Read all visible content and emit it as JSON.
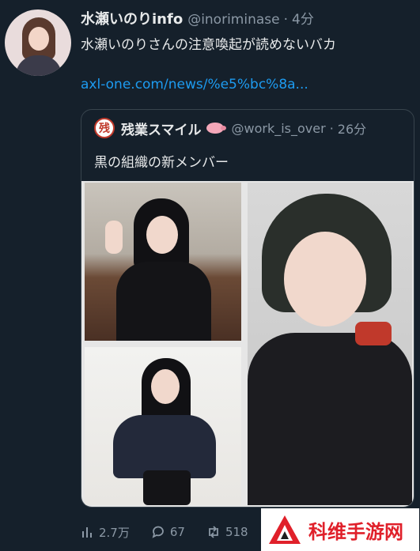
{
  "tweet": {
    "display_name": "水瀬いのりinfo",
    "handle": "@inoriminase",
    "separator": "·",
    "time": "4分",
    "text": "水瀬いのりさんの注意喚起が読めないバカ",
    "link": "axl-one.com/news/%e5%bc%8a..."
  },
  "quote": {
    "avatar_glyph": "残",
    "display_name": "残業スマイル",
    "handle": "@work_is_over",
    "separator": "·",
    "time": "26分",
    "text": "黒の組織の新メンバー",
    "media_count": 3
  },
  "actions": {
    "views": "2.7万",
    "replies": "67",
    "retweets": "518"
  },
  "watermark": {
    "text": "科维手游网"
  },
  "colors": {
    "background": "#15202b",
    "primary_text": "#e7e9ea",
    "secondary_text": "#8b98a5",
    "link": "#1d9bf0",
    "border": "#38444d",
    "watermark_red": "#e0202a"
  },
  "icons": [
    "views-icon",
    "reply-icon",
    "retweet-icon",
    "pig-icon",
    "watermark-logo-icon"
  ]
}
